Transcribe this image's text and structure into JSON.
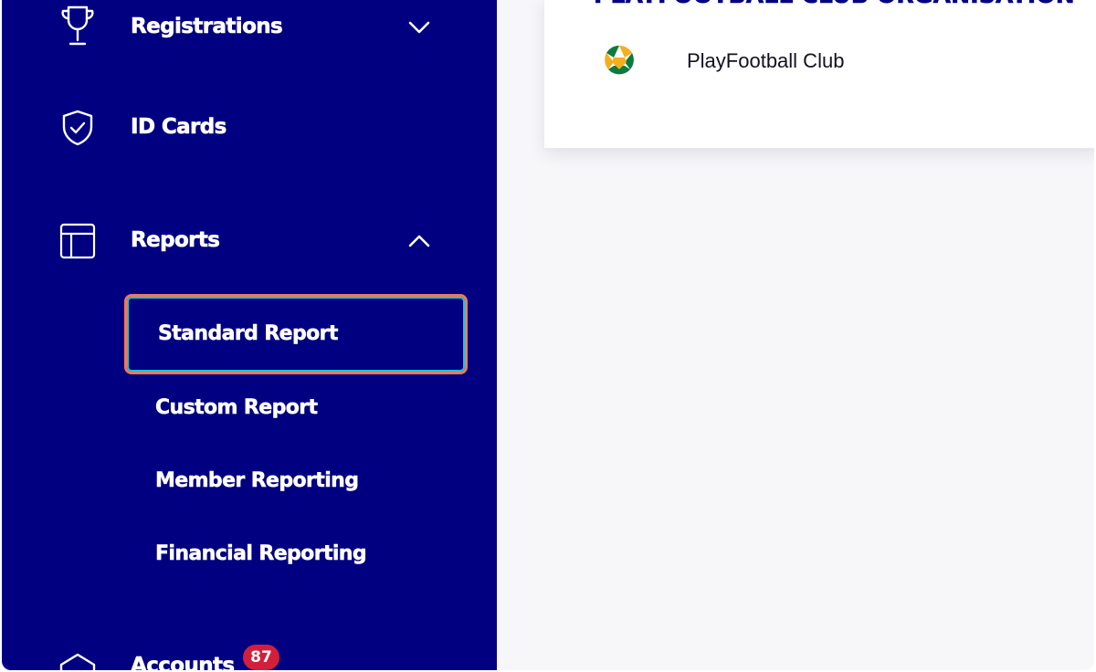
{
  "sidebar": {
    "items": [
      {
        "label": "Registrations",
        "icon": "trophy-icon",
        "chevron": "chevron-down-icon"
      },
      {
        "label": "ID Cards",
        "icon": "shield-check-icon"
      },
      {
        "label": "Reports",
        "icon": "layout-icon",
        "chevron": "chevron-up-icon"
      }
    ],
    "reports_submenu": [
      {
        "label": "Standard Report",
        "selected": true
      },
      {
        "label": "Custom Report",
        "selected": false
      },
      {
        "label": "Member Reporting",
        "selected": false
      },
      {
        "label": "Financial Reporting",
        "selected": false
      }
    ],
    "next_item": {
      "label": "Accounts",
      "icon": "accounts-icon",
      "badge": "87"
    }
  },
  "main": {
    "org_heading": "PLAYFOOTBALL CLUB ORGANISATION",
    "club": {
      "name": "PlayFootball Club",
      "logo": "football-logo-icon"
    }
  },
  "colors": {
    "sidebar_bg": "#000080",
    "highlight_border": "#f0785a",
    "highlight_inner": "#1ec3d1",
    "badge_bg": "#d21f3c",
    "content_bg": "#f7f7fa"
  }
}
